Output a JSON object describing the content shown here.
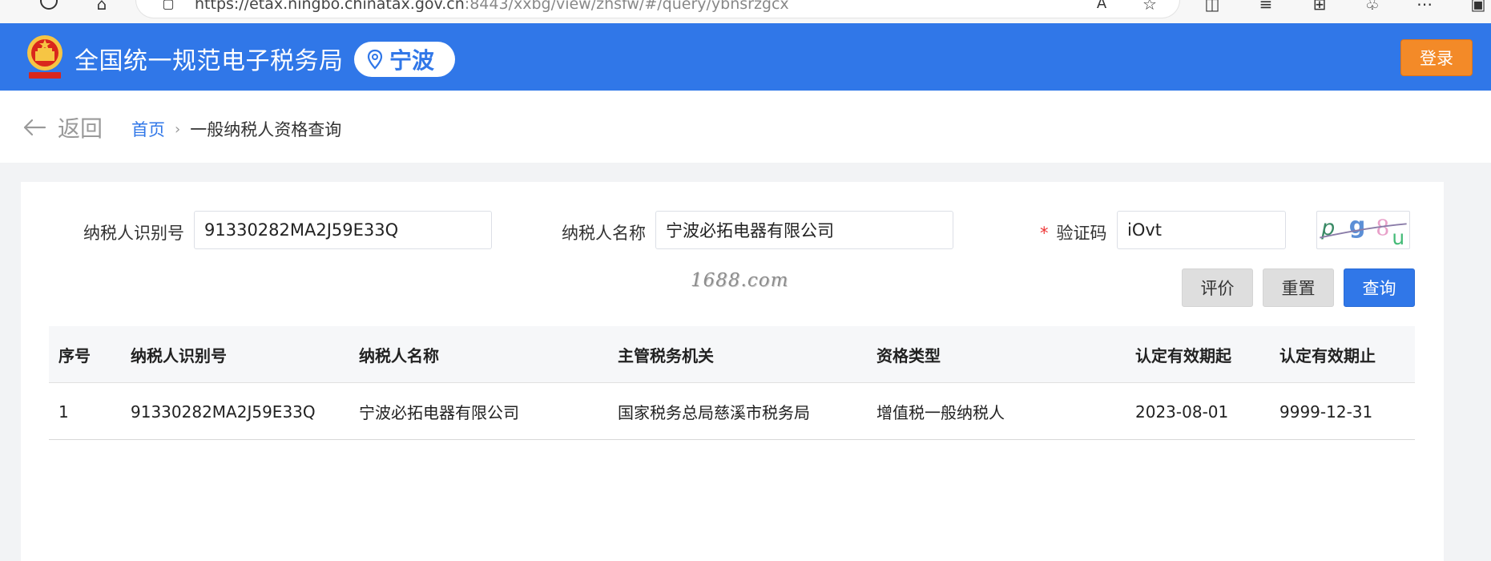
{
  "browser": {
    "url_main": "https://etax.ningbo.chinatax.gov.cn",
    "url_rest": ":8443/xxbg/view/zhsfw/#/query/ybnsrzgcx"
  },
  "header": {
    "site_title": "全国统一规范电子税务局",
    "city": "宁波",
    "login_label": "登录",
    "brand_color": "#3077e8",
    "login_color": "#f38a28"
  },
  "breadcrumb": {
    "back_label": "返回",
    "home": "首页",
    "separator": "›",
    "current": "一般纳税人资格查询"
  },
  "form": {
    "taxpayer_id_label": "纳税人识别号",
    "taxpayer_id_value": "91330282MA2J59E33Q",
    "taxpayer_name_label": "纳税人名称",
    "taxpayer_name_value": "宁波必拓电器有限公司",
    "required_mark": "*",
    "captcha_label": "验证码",
    "captcha_value": "iOvt"
  },
  "watermark": "1688.com",
  "buttons": {
    "evaluate": "评价",
    "reset": "重置",
    "search": "查询"
  },
  "table": {
    "headers": [
      "序号",
      "纳税人识别号",
      "纳税人名称",
      "主管税务机关",
      "资格类型",
      "认定有效期起",
      "认定有效期止"
    ],
    "rows": [
      [
        "1",
        "91330282MA2J59E33Q",
        "宁波必拓电器有限公司",
        "国家税务总局慈溪市税务局",
        "增值税一般纳税人",
        "2023-08-01",
        "9999-12-31"
      ]
    ]
  }
}
